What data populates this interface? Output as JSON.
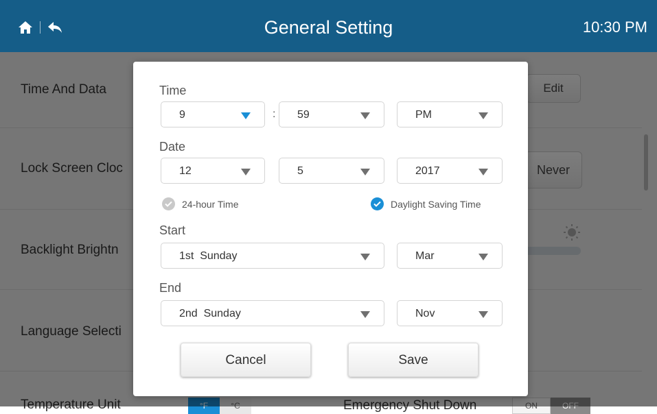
{
  "header": {
    "title": "General Setting",
    "time": "10:30 PM",
    "home_icon": "home-icon",
    "back_icon": "back-icon"
  },
  "background": {
    "rows": [
      {
        "label": "Time And Data",
        "action": "Edit"
      },
      {
        "label": "Lock Screen Cloc",
        "action": "Never"
      },
      {
        "label": "Backlight Brightn"
      },
      {
        "label": "Language Selecti"
      },
      {
        "label": "Temperature Unit"
      }
    ],
    "brightness_icon": "sun-icon",
    "unit_options": [
      "°F",
      "°C"
    ],
    "emergency_label": "Emergency Shut Down",
    "emergency_options": [
      "ON",
      "OFF"
    ]
  },
  "dialog": {
    "time_label": "Time",
    "hour": "9",
    "minute": "59",
    "ampm": "PM",
    "colon": ":",
    "date_label": "Date",
    "month": "12",
    "day": "5",
    "year": "2017",
    "hour24_label": "24-hour Time",
    "hour24_checked": false,
    "dst_label": "Daylight Saving Time",
    "dst_checked": true,
    "start_label": "Start",
    "start_week": "1st  Sunday",
    "start_month": "Mar",
    "end_label": "End",
    "end_week": "2nd  Sunday",
    "end_month": "Nov",
    "cancel": "Cancel",
    "save": "Save"
  },
  "colors": {
    "header": "#155d88",
    "accent": "#1a8fd6",
    "overlay": "rgba(0,0,0,0.5)"
  }
}
